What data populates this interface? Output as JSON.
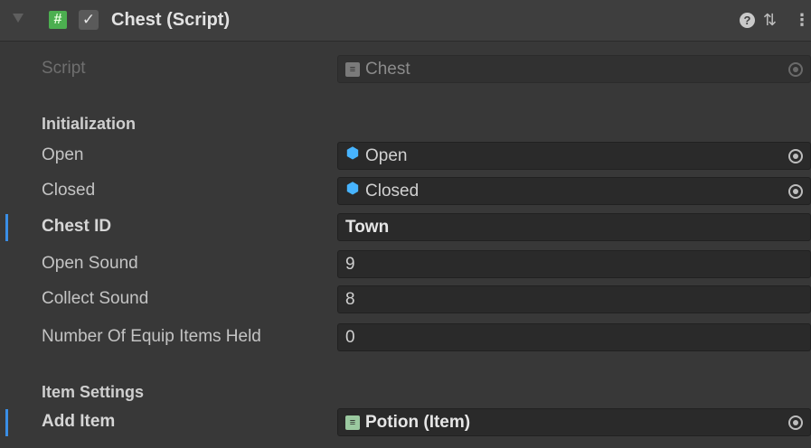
{
  "header": {
    "title": "Chest (Script)",
    "script_icon_glyph": "#",
    "check_glyph": "✓",
    "icons": [
      "foldout-arrow-icon",
      "script-icon",
      "checkbox-icon",
      "help-icon",
      "presets-icon",
      "more-options-icon"
    ]
  },
  "script_row": {
    "label": "Script",
    "value": "Chest"
  },
  "sections": {
    "initialization": "Initialization",
    "item_settings": "Item Settings"
  },
  "fields": {
    "open": {
      "label": "Open",
      "value": "Open"
    },
    "closed": {
      "label": "Closed",
      "value": "Closed"
    },
    "chest_id": {
      "label": "Chest ID",
      "value": "Town"
    },
    "open_sound": {
      "label": "Open Sound",
      "value": "9"
    },
    "collect_sound": {
      "label": "Collect Sound",
      "value": "8"
    },
    "num_equip": {
      "label": "Number Of Equip Items Held",
      "value": "0"
    },
    "add_item": {
      "label": "Add Item",
      "value": "Potion (Item)"
    }
  },
  "colors": {
    "background": "#383838",
    "header": "#3e3e3e",
    "field": "#2a2a2a",
    "accent_blue": "#3a8ee6",
    "script_green": "#4caf50",
    "prefab_blue": "#47b4ff"
  }
}
